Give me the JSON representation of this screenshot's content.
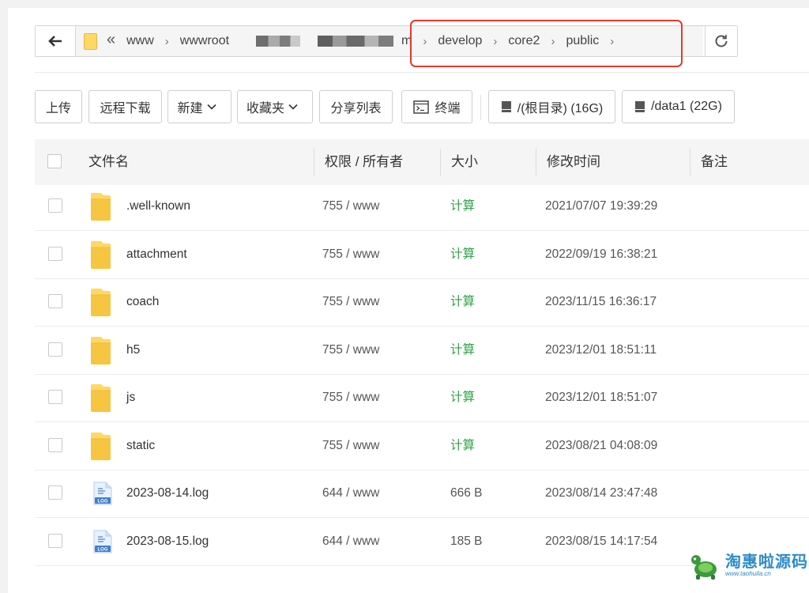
{
  "address_bar": {
    "crumbs_before": [
      "www",
      "wwwroot"
    ],
    "crumbs_after": [
      "develop",
      "core2",
      "public"
    ],
    "crumb_fragment": "m"
  },
  "toolbar": {
    "upload": "上传",
    "remote_download": "远程下载",
    "new": "新建",
    "favorites": "收藏夹",
    "share_list": "分享列表",
    "terminal": "终端",
    "disk_root": "/(根目录) (16G)",
    "disk_data1": "/data1 (22G)"
  },
  "table": {
    "headers": {
      "name": "文件名",
      "perm": "权限 / 所有者",
      "size": "大小",
      "mtime": "修改时间",
      "note": "备注"
    },
    "rows": [
      {
        "type": "folder",
        "name": ".well-known",
        "perm": "755 / www",
        "size": "计算",
        "mtime": "2021/07/07 19:39:29"
      },
      {
        "type": "folder",
        "name": "attachment",
        "perm": "755 / www",
        "size": "计算",
        "mtime": "2022/09/19 16:38:21"
      },
      {
        "type": "folder",
        "name": "coach",
        "perm": "755 / www",
        "size": "计算",
        "mtime": "2023/11/15 16:36:17"
      },
      {
        "type": "folder",
        "name": "h5",
        "perm": "755 / www",
        "size": "计算",
        "mtime": "2023/12/01 18:51:11"
      },
      {
        "type": "folder",
        "name": "js",
        "perm": "755 / www",
        "size": "计算",
        "mtime": "2023/12/01 18:51:07"
      },
      {
        "type": "folder",
        "name": "static",
        "perm": "755 / www",
        "size": "计算",
        "mtime": "2023/08/21 04:08:09"
      },
      {
        "type": "log",
        "name": "2023-08-14.log",
        "perm": "644 / www",
        "size": "666 B",
        "mtime": "2023/08/14 23:47:48"
      },
      {
        "type": "log",
        "name": "2023-08-15.log",
        "perm": "644 / www",
        "size": "185 B",
        "mtime": "2023/08/15 14:17:54"
      }
    ]
  },
  "icons": {
    "back": "arrow-left-icon",
    "refresh": "refresh-icon",
    "folder": "folder-icon",
    "log": "log-file-icon",
    "terminal": "terminal-icon",
    "disk": "disk-icon"
  },
  "colors": {
    "calc_link": "#2fa347",
    "highlight_border": "#e5392c",
    "folder": "#ffd765"
  },
  "watermark": {
    "main": "淘惠啦源码",
    "sub": "www.taohuila.cn"
  }
}
